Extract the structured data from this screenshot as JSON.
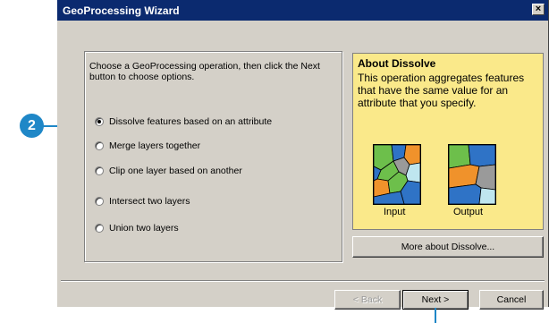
{
  "window": {
    "title": "GeoProcessing Wizard",
    "close_glyph": "×"
  },
  "callout": {
    "number": "2"
  },
  "instruction": "Choose a GeoProcessing operation, then click the Next button to choose options.",
  "options": [
    {
      "label": "Dissolve features based on an attribute",
      "selected": true
    },
    {
      "label": "Merge layers together",
      "selected": false
    },
    {
      "label": "Clip one layer based on another",
      "selected": false
    },
    {
      "label": "Intersect two layers",
      "selected": false
    },
    {
      "label": "Union two layers",
      "selected": false
    }
  ],
  "about": {
    "title": "About Dissolve",
    "text": "This operation aggregates features that have the same value for an attribute that you specify.",
    "input_label": "Input",
    "output_label": "Output",
    "more_button": "More about Dissolve...",
    "colors": {
      "panel": "#fae98a",
      "green": "#6dbf4b",
      "blue": "#2f73c6",
      "orange": "#f0922b",
      "pale": "#bfe6ef",
      "gray": "#9a9a9a"
    }
  },
  "buttons": {
    "back": "< Back",
    "next": "Next >",
    "cancel": "Cancel"
  }
}
